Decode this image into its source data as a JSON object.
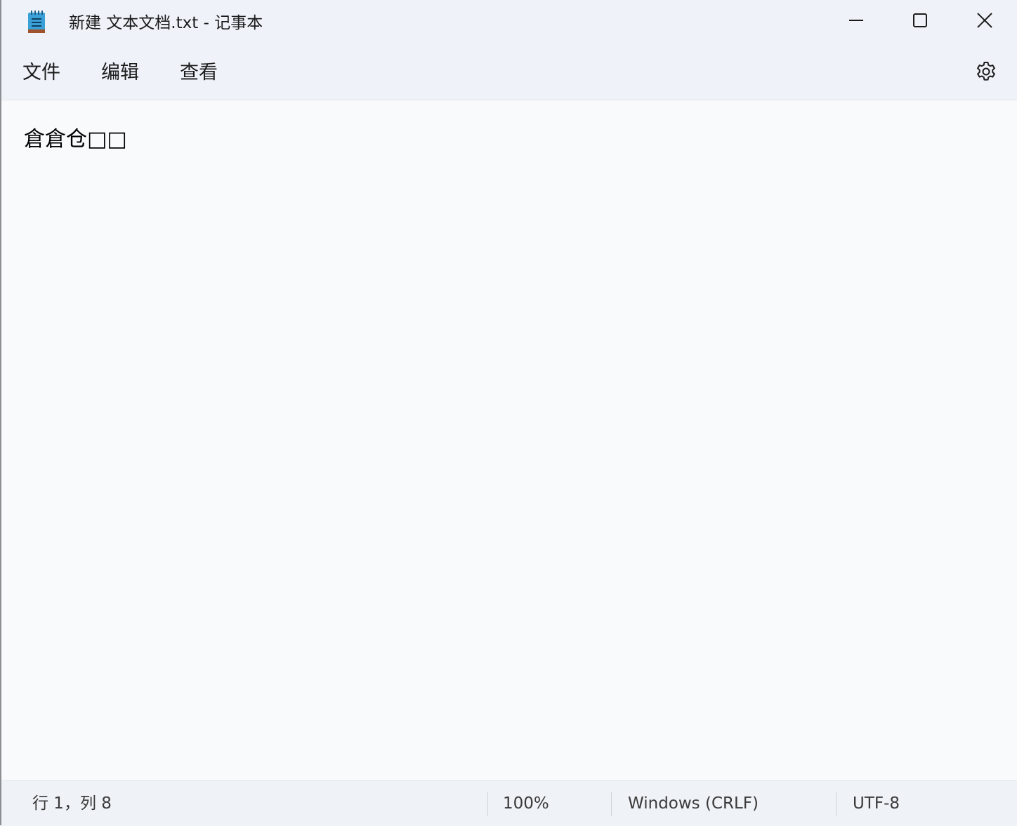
{
  "window": {
    "title": "新建 文本文档.txt - 记事本"
  },
  "titlebar": {
    "app_icon": "notepad-icon",
    "minimize_icon": "minimize-icon",
    "maximize_icon": "maximize-icon",
    "close_icon": "close-icon"
  },
  "menu": {
    "items": [
      {
        "label": "文件"
      },
      {
        "label": "编辑"
      },
      {
        "label": "查看"
      }
    ],
    "settings_icon": "gear-icon"
  },
  "editor": {
    "content": "倉倉仓□□"
  },
  "status": {
    "position": "行 1，列 8",
    "zoom": "100%",
    "line_ending": "Windows (CRLF)",
    "encoding": "UTF-8"
  },
  "colors": {
    "chrome_bg": "#eff3f9",
    "editor_bg": "#f9fafb",
    "text": "#1b1b1b",
    "icon_blue": "#3aa0d8",
    "icon_brown": "#a0522d"
  }
}
